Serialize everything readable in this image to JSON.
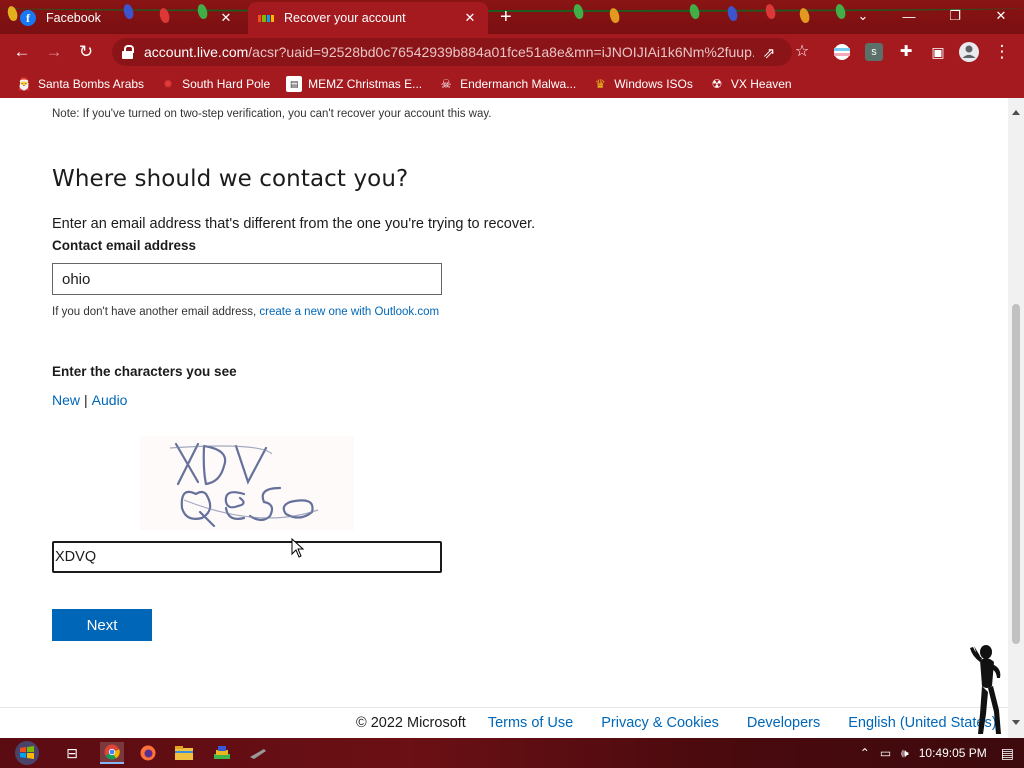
{
  "tabs": [
    {
      "title": "Facebook",
      "favicon": "facebook-icon"
    },
    {
      "title": "Recover your account",
      "favicon": "microsoft-icon",
      "active": true
    }
  ],
  "address_bar": {
    "host": "account.live.com",
    "path": "/acsr?uaid=92528bd0c76542939b884a01fce51a8e&mn=iJNOIJIAi1k6Nm%2fuup..."
  },
  "bookmarks": [
    {
      "label": "Santa Bombs Arabs",
      "icon": "bookmark-icon"
    },
    {
      "label": "South Hard Pole",
      "icon": "maple-leaf-icon"
    },
    {
      "label": "MEMZ Christmas E...",
      "icon": "page-icon"
    },
    {
      "label": "Endermanch Malwa...",
      "icon": "skull-icon"
    },
    {
      "label": "Windows ISOs",
      "icon": "trophy-icon"
    },
    {
      "label": "VX Heaven",
      "icon": "heaven-icon"
    }
  ],
  "page": {
    "note": "Note: If you've turned on two-step verification, you can't recover your account this way.",
    "heading": "Where should we contact you?",
    "instruction": "Enter an email address that's different from the one you're trying to recover.",
    "email_label": "Contact email address",
    "email_value": "ohio",
    "alt_prefix": "If you don't have another email address,",
    "alt_link": "create a new one with Outlook.com",
    "captcha_label": "Enter the characters you see",
    "captcha_new": "New",
    "captcha_sep": "|",
    "captcha_audio": "Audio",
    "captcha_value": "XDVQ",
    "next_label": "Next"
  },
  "footer": {
    "copyright": "© 2022 Microsoft",
    "links": [
      "Terms of Use",
      "Privacy & Cookies",
      "Developers",
      "English (United States)"
    ]
  },
  "taskbar": {
    "clock": "10:49:05 PM"
  },
  "colors": {
    "theme_red": "#a41a1f",
    "link_blue": "#0067b8",
    "button_blue": "#0067b8"
  }
}
